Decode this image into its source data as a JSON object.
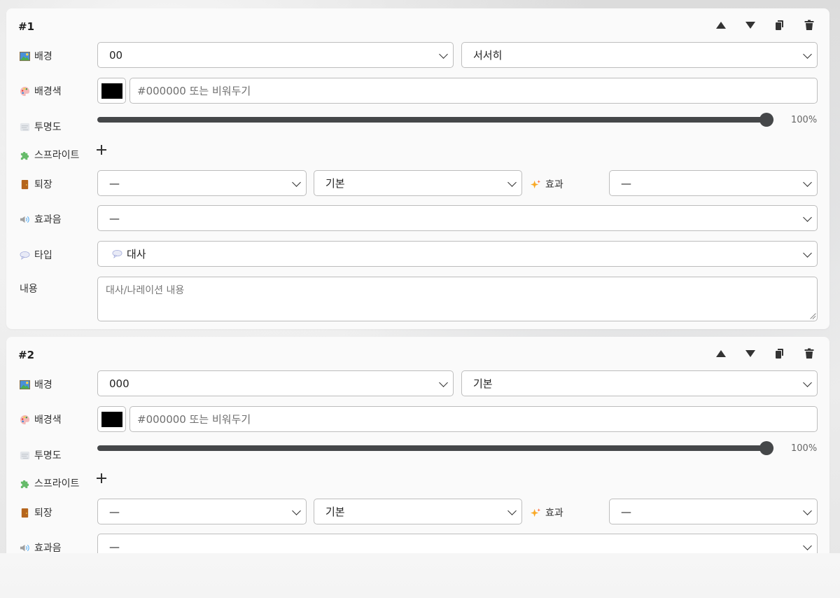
{
  "colors": {
    "card": "#fafafa",
    "border": "#bdbdbd",
    "slider": "#454749",
    "swatch": "#000000"
  },
  "scenes": [
    {
      "title": "#1",
      "labels": {
        "background": "배경",
        "bg_color": "배경색",
        "opacity": "투명도",
        "sprite": "스프라이트",
        "exit": "퇴장",
        "effect": "효과",
        "sound": "효과음",
        "type": "타입",
        "content": "내용"
      },
      "background_value": "00",
      "transition_value": "서서히",
      "color_placeholder": "#000000 또는 비워두기",
      "opacity": 100,
      "opacity_text": "100%",
      "exit_value": "—",
      "exit_style": "기본",
      "effect_value": "—",
      "sound_value": "—",
      "type_value": "대사",
      "content_placeholder": "대사/나레이션 내용"
    },
    {
      "title": "#2",
      "labels": {
        "background": "배경",
        "bg_color": "배경색",
        "opacity": "투명도",
        "sprite": "스프라이트",
        "exit": "퇴장",
        "effect": "효과",
        "sound": "효과음"
      },
      "background_value": "000",
      "transition_value": "기본",
      "color_placeholder": "#000000 또는 비워두기",
      "opacity": 100,
      "opacity_text": "100%",
      "exit_value": "—",
      "exit_style": "기본",
      "effect_value": "—",
      "sound_value": "—"
    }
  ],
  "icons": {
    "move_up": "triangle-up-icon",
    "move_down": "triangle-down-icon",
    "duplicate": "copy-icon",
    "delete": "trash-icon",
    "background": "picture-icon",
    "bg_color": "palette-icon",
    "opacity": "fog-icon",
    "sprite": "puzzle-icon",
    "exit": "door-icon",
    "effect": "sparkles-icon",
    "sound": "speaker-icon",
    "type": "speech-bubble-icon"
  }
}
